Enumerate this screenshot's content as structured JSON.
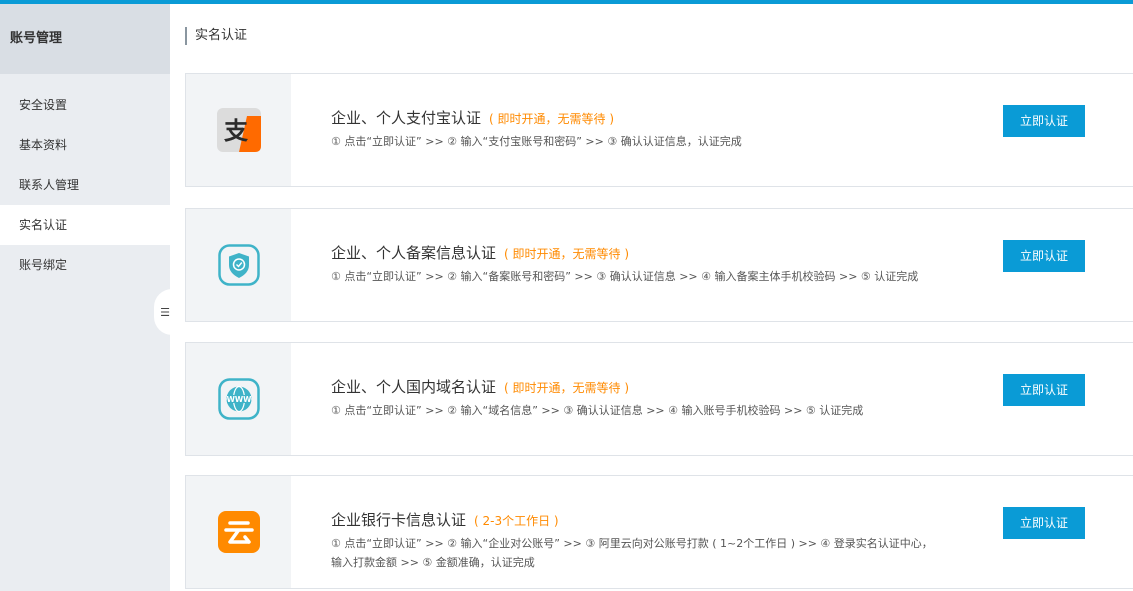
{
  "colors": {
    "accent": "#0a9bd6",
    "note_orange": "#ff8a00",
    "sidebar_bg": "#eaedf1"
  },
  "sidebar": {
    "title": "账号管理",
    "items": [
      {
        "label": "安全设置",
        "active": false
      },
      {
        "label": "基本资料",
        "active": false
      },
      {
        "label": "联系人管理",
        "active": false
      },
      {
        "label": "实名认证",
        "active": true
      },
      {
        "label": "账号绑定",
        "active": false
      }
    ],
    "collapse_icon": "collapse-menu-icon",
    "collapse_glyph": "☰"
  },
  "main": {
    "title": "实名认证",
    "cards": [
      {
        "icon": "alipay-icon",
        "title": "企业、个人支付宝认证",
        "note": "( 即时开通，无需等待 )",
        "steps": "① 点击“立即认证” >> ② 输入“支付宝账号和密码” >> ③ 确认认证信息，认证完成",
        "button": "立即认证"
      },
      {
        "icon": "beian-shield-icon",
        "title": "企业、个人备案信息认证",
        "note": "( 即时开通，无需等待 )",
        "steps": "① 点击“立即认证” >> ② 输入“备案账号和密码” >> ③ 确认认证信息 >> ④ 输入备案主体手机校验码 >> ⑤ 认证完成",
        "button": "立即认证"
      },
      {
        "icon": "www-globe-icon",
        "title": "企业、个人国内域名认证",
        "note": "( 即时开通，无需等待 )",
        "steps": "① 点击“立即认证” >> ② 输入“域名信息” >> ③ 确认认证信息 >> ④ 输入账号手机校验码 >> ⑤ 认证完成",
        "button": "立即认证"
      },
      {
        "icon": "aliyun-bank-icon",
        "title": "企业银行卡信息认证",
        "note": "( 2-3个工作日 )",
        "steps": "① 点击“立即认证” >> ② 输入“企业对公账号” >> ③ 阿里云向对公账号打款 ( 1~2个工作日 ) >> ④ 登录实名认证中心，输入打款金额 >> ⑤ 金额准确，认证完成",
        "button": "立即认证"
      }
    ]
  }
}
